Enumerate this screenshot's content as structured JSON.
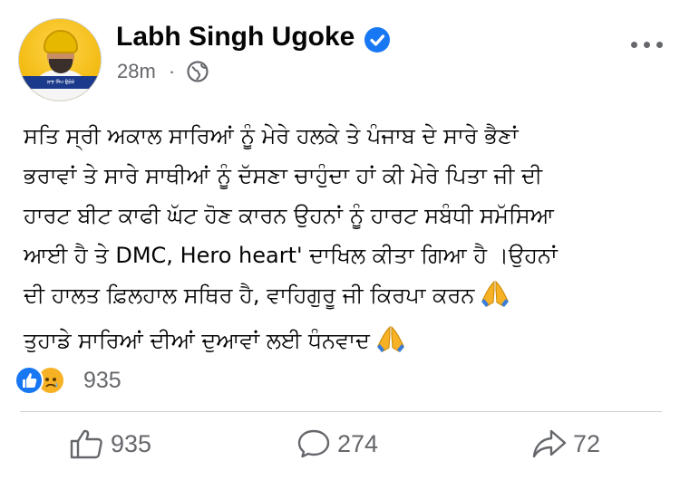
{
  "post": {
    "author": "Labh Singh Ugoke",
    "time": "28m",
    "dot": "·",
    "avatar_banner_text": "ਲਾਭ ਸਿੰਘ ਉਗੋਕੇ",
    "text_lines": [
      "ਸਤਿ ਸ੍ਰੀ ਅਕਾਲ ਸਾਰਿਆਂ ਨੂੰ ਮੇਰੇ ਹਲਕੇ ਤੇ ਪੰਜਾਬ ਦੇ ਸਾਰੇ ਭੈਣਾਂ",
      "ਭਰਾਵਾਂ ਤੇ ਸਾਰੇ ਸਾਥੀਆਂ ਨੂੰ ਦੱਸਣਾ ਚਾਹੁੰਦਾ ਹਾਂ ਕੀ ਮੇਰੇ ਪਿਤਾ ਜੀ ਦੀ",
      "ਹਾਰਟ ਬੀਟ ਕਾਫੀ ਘੱਟ ਹੋਣ ਕਾਰਨ ਉਹਨਾਂ ਨੂੰ ਹਾਰਟ ਸਬੰਧੀ ਸਮੱਸਿਆ",
      "ਆਈ ਹੈ ਤੇ DMC, Hero heart' ਦਾਖਿਲ ਕੀਤਾ ਗਿਆ ਹੈ ।ਉਹਨਾਂ",
      "ਦੀ ਹਾਲਤ ਫ਼ਿਲਹਾਲ ਸਥਿਰ ਹੈ, ਵਾਹਿਗੁਰੂ ਜੀ ਕਿਰਪਾ ਕਰਨ",
      "ਤੁਹਾਡੇ ਸਾਰਿਆਂ ਦੀਆਂ ਦੁਆਵਾਂ ਲਈ ਧੰਨਵਾਦ"
    ]
  },
  "reactions": {
    "icons": [
      "like-icon",
      "sad-icon"
    ],
    "count": "935"
  },
  "actions": {
    "like_count": "935",
    "comment_count": "274",
    "share_count": "72"
  },
  "colors": {
    "brand_blue": "#1877f2",
    "secondary_text": "#65676b",
    "primary_text": "#050505"
  }
}
